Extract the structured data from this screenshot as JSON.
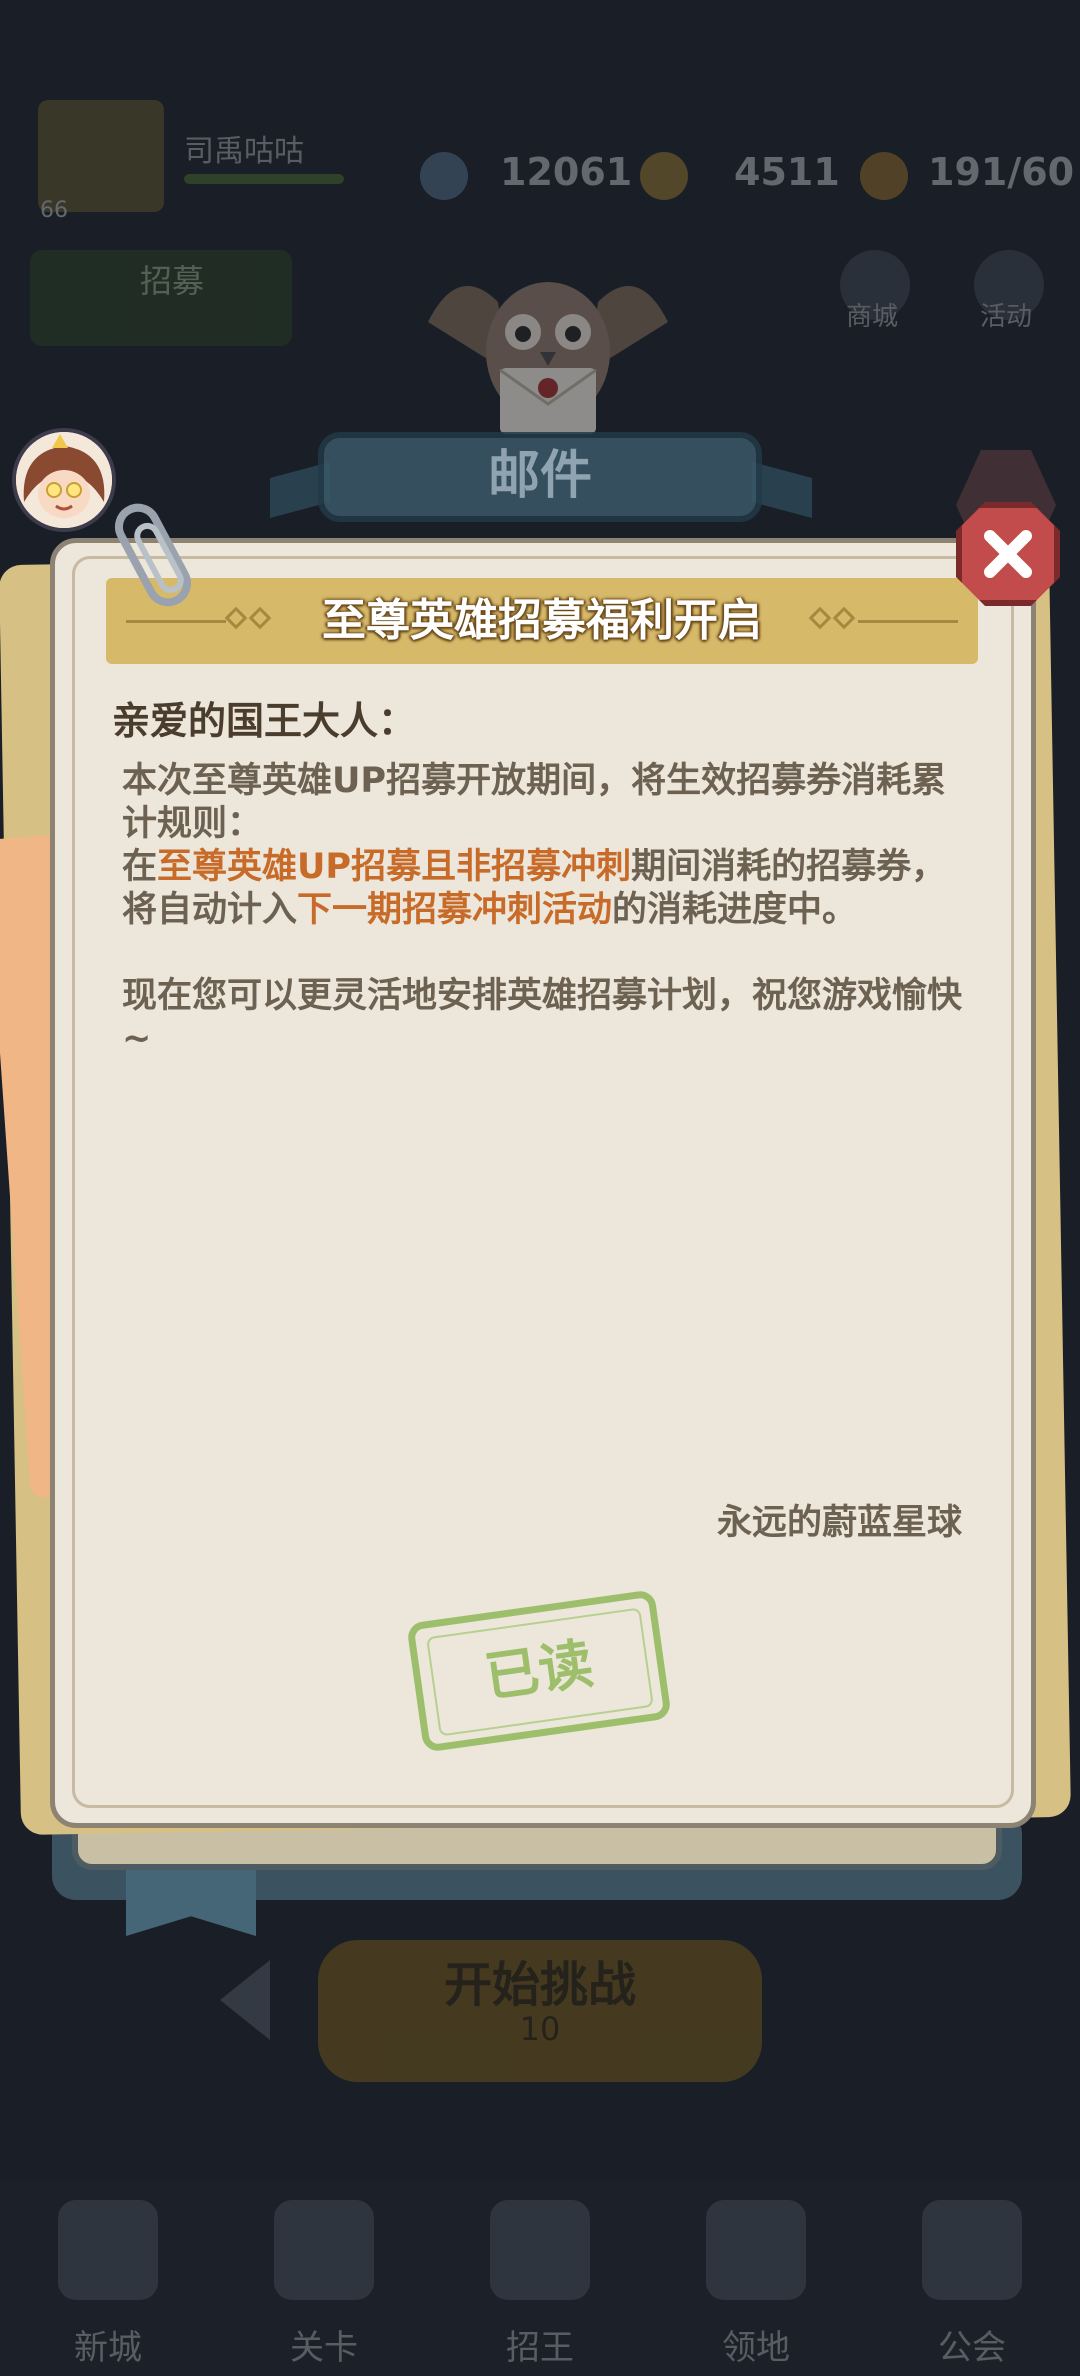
{
  "background": {
    "player": {
      "name": "司禹咕咕",
      "level": "66"
    },
    "resources": [
      {
        "icon": "gem-icon",
        "value": "12061"
      },
      {
        "icon": "coin-icon",
        "value": "4511"
      },
      {
        "icon": "stamina-icon",
        "value": "191/60"
      }
    ],
    "side_buttons": [
      {
        "icon": "gift-icon",
        "label": "商城"
      },
      {
        "icon": "event-icon",
        "label": "活动"
      }
    ],
    "green_panel_label": "招募",
    "start_button": {
      "label": "开始挑战",
      "cost": "10"
    },
    "nav": [
      {
        "label": "新城",
        "icon": "castle-icon"
      },
      {
        "label": "关卡",
        "icon": "map-icon"
      },
      {
        "label": "招王",
        "icon": "crown-icon"
      },
      {
        "label": "领地",
        "icon": "tower-icon"
      },
      {
        "label": "公会",
        "icon": "globe-icon"
      }
    ]
  },
  "mail": {
    "header_title": "邮件",
    "banner_title": "至尊英雄招募福利开启",
    "greeting": "亲爱的国王大人：",
    "line1": "本次至尊英雄UP招募开放期间，将生效招募券消耗累计规则：",
    "line2_prefix": "在",
    "line2_hl1": "至尊英雄UP招募且非招募冲刺",
    "line2_mid": "期间消耗的招募券，将自动计入",
    "line2_hl2": "下一期招募冲刺活动",
    "line2_suffix": "的消耗进度中。",
    "line3": "现在您可以更灵活地安排英雄招募计划，祝您游戏愉快~",
    "signature": "永远的蔚蓝星球",
    "stamp": "已读"
  },
  "colors": {
    "highlight": "#c86a28",
    "banner": "#d7b96a",
    "paper": "#ece6db",
    "close": "#c24b4b",
    "stamp": "#9dbf6c"
  }
}
